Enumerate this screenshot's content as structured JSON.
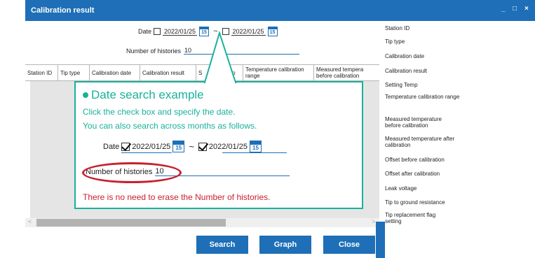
{
  "window": {
    "title": "Calibration result",
    "minimize": "_",
    "maximize": "□",
    "close": "×"
  },
  "form": {
    "date_label": "Date",
    "date_from": "2022/01/25",
    "date_to": "2022/01/25",
    "calendar_day": "15",
    "tilde": "~",
    "histories_label": "Number of histories",
    "histories_value": "10"
  },
  "table": {
    "headers": [
      "Station ID",
      "Tip type",
      "Calibration date",
      "Calibration result",
      "S",
      "Temp",
      "Temperature calibration range",
      "Measured tempera before calibration"
    ]
  },
  "side_list": [
    "Station ID",
    "Tip type",
    "Calibration date",
    "Calibration result",
    "Setting Temp",
    "Temperature calibration range",
    "Measured temperature before calibration",
    "Measured temperature after calibration",
    "Offset before calibration",
    "Offset after calibration",
    "Leak voltage",
    "Tip to ground resistance",
    "Tip replacement flag setting"
  ],
  "buttons": {
    "search": "Search",
    "graph": "Graph",
    "close": "Close"
  },
  "callout": {
    "title": "Date search example",
    "line1": "Click the check box and specify the date.",
    "line2": "You can also search across months as follows.",
    "date_label": "Date",
    "date_from": "2022/01/25",
    "date_to": "2022/01/25",
    "calendar_day": "15",
    "tilde": "~",
    "histories_label": "Number of histories",
    "histories_value": "10",
    "warning": "There is no need to erase the Number of histories."
  },
  "colors": {
    "accent": "#1e6fb7",
    "callout": "#19b19a",
    "highlight": "#c8202f"
  }
}
